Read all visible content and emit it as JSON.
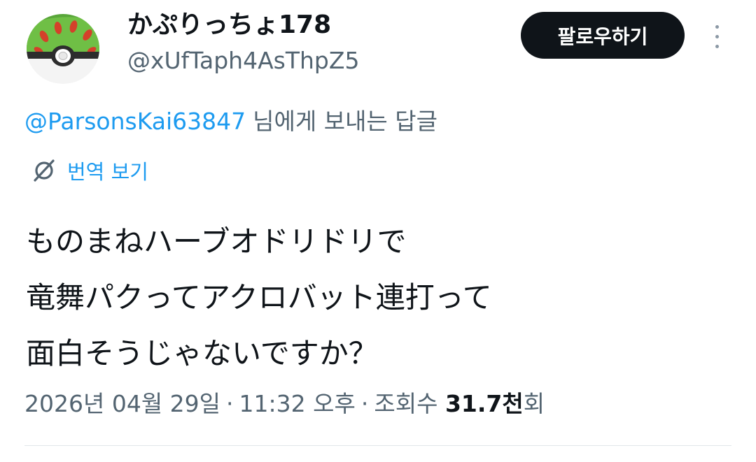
{
  "header": {
    "display_name": "かぷりっちょ178",
    "handle": "@xUfTaph4AsThpZ5",
    "follow_label": "팔로우하기",
    "more_icon": "more-dots-icon"
  },
  "reply": {
    "mention": "@ParsonsKai63847",
    "suffix": "님에게 보내는 답글"
  },
  "translate": {
    "icon": "translate-icon",
    "label": "번역 보기"
  },
  "body": {
    "lines": [
      "ものまねハーブオドリドリで",
      "竜舞パクってアクロバット連打って",
      "面白そうじゃないですか？"
    ]
  },
  "meta": {
    "date": "2026년 04월 29일",
    "separator": "·",
    "time": "11:32 오후",
    "views_label": "조회수",
    "views_count": "31.7천",
    "views_suffix": "회"
  },
  "colors": {
    "text": "#0f1419",
    "secondary": "#536471",
    "link": "#1d9bf0",
    "follow_bg": "#0f1419",
    "divider": "#e1e6ea"
  }
}
